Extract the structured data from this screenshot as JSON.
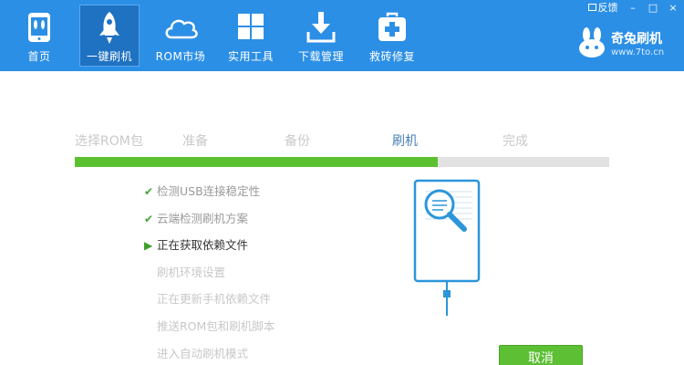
{
  "nav": {
    "items": [
      {
        "label": "首页",
        "icon": "home-icon"
      },
      {
        "label": "一键刷机",
        "icon": "rocket-icon"
      },
      {
        "label": "ROM市场",
        "icon": "cloud-icon"
      },
      {
        "label": "实用工具",
        "icon": "windows-grid-icon"
      },
      {
        "label": "下载管理",
        "icon": "download-icon"
      },
      {
        "label": "救砖修复",
        "icon": "first-aid-kit-icon"
      }
    ],
    "active_index": 1
  },
  "window": {
    "feedback_label": "反馈",
    "minimize": "–",
    "maximize": "□",
    "close": "×"
  },
  "brand": {
    "name": "奇兔刷机",
    "url": "www.7to.cn"
  },
  "steps": {
    "items": [
      "选择ROM包",
      "准备",
      "备份",
      "刷机",
      "完成"
    ],
    "current_index": 3
  },
  "progress": {
    "fraction": 0.68
  },
  "tasks": [
    {
      "label": "检测USB连接稳定性",
      "status": "done"
    },
    {
      "label": "云端检测刷机方案",
      "status": "done"
    },
    {
      "label": "正在获取依赖文件",
      "status": "current"
    },
    {
      "label": "刷机环境设置",
      "status": "pending"
    },
    {
      "label": "正在更新手机依赖文件",
      "status": "pending"
    },
    {
      "label": "推送ROM包和刷机脚本",
      "status": "pending"
    },
    {
      "label": "进入自动刷机模式",
      "status": "pending"
    }
  ],
  "actions": {
    "cancel_label": "取消"
  },
  "colors": {
    "header_blue": "#2c8fe6",
    "active_tab": "#1f72c2",
    "progress_green": "#5cc130",
    "illustration_blue": "#2b96d9"
  }
}
